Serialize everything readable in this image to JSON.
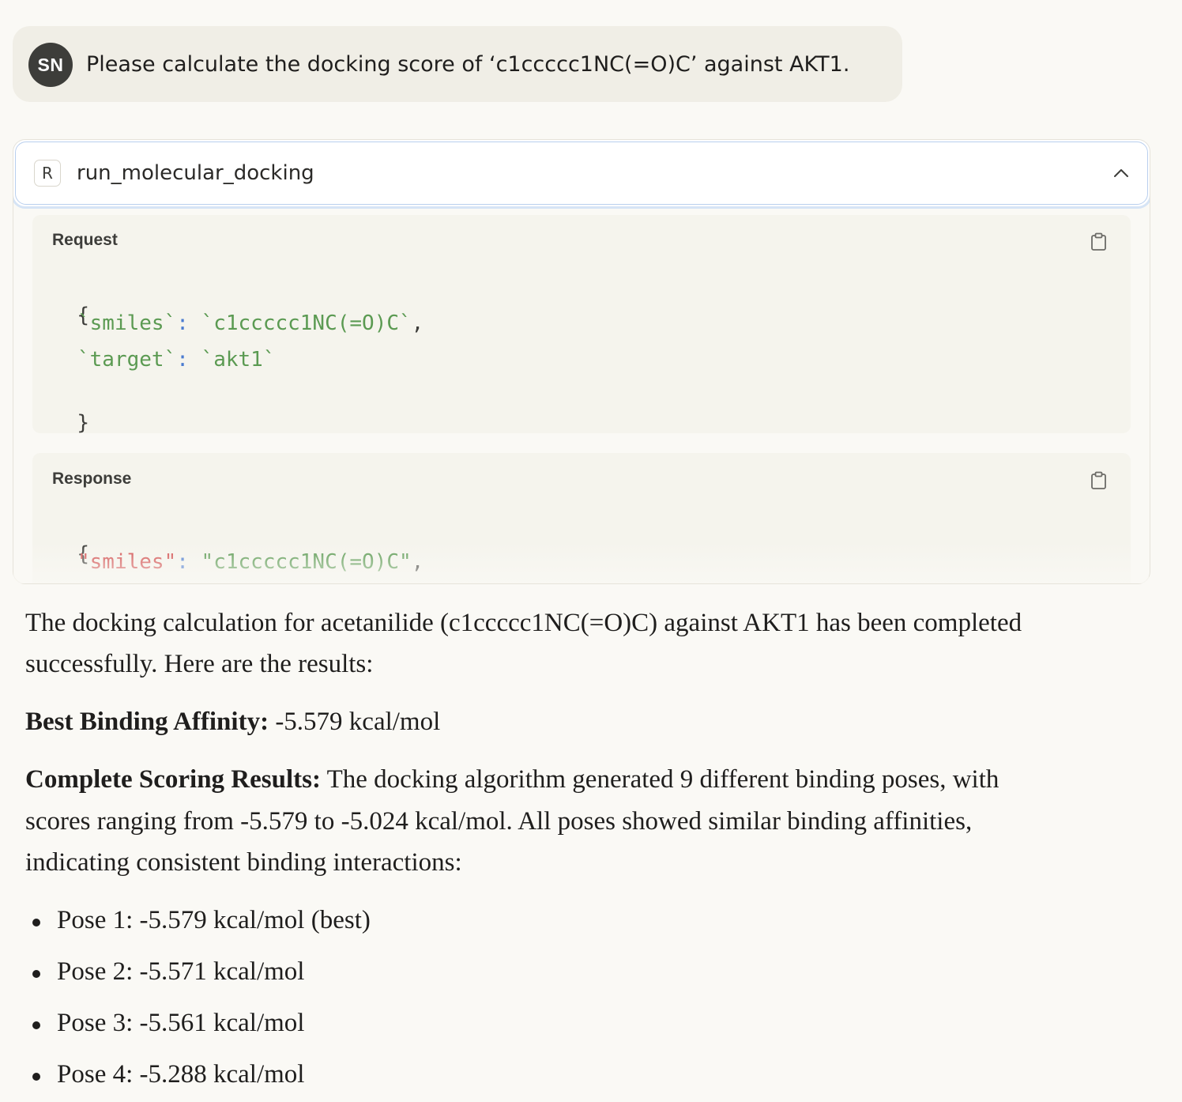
{
  "user_message": {
    "avatar_initials": "SN",
    "text": "Please calculate the docking score of ‘c1ccccc1NC(=O)C’ against AKT1."
  },
  "tool_call": {
    "badge": "R",
    "name": "run_molecular_docking",
    "collapse_icon": "chevron-up-icon",
    "request": {
      "label": "Request",
      "copy_icon": "clipboard-icon",
      "lines": {
        "open": "{",
        "smiles_key": "`smiles`",
        "colon": ":",
        "smiles_value": "`c1ccccc1NC(=O)C`",
        "comma": ",",
        "target_key": "`target`",
        "target_value": "`akt1`",
        "close": "}"
      }
    },
    "response": {
      "label": "Response",
      "copy_icon": "clipboard-icon",
      "lines": {
        "open": "{",
        "smiles_key": "\"smiles\"",
        "colon": ":",
        "smiles_value": "\"c1ccccc1NC(=O)C\"",
        "comma": ","
      }
    }
  },
  "answer": {
    "intro_line1": "The docking calculation for acetanilide (c1ccccc1NC(=O)C) against AKT1 has been completed",
    "intro_line2": "successfully. Here are the results:",
    "best_label": "Best Binding Affinity:",
    "best_value": " -5.579 kcal/mol",
    "complete_label": "Complete Scoring Results:",
    "complete_line1": " The docking algorithm generated 9 different binding poses, with",
    "complete_line2": "scores ranging from -5.579 to -5.024 kcal/mol. All poses showed similar binding affinities,",
    "complete_line3": "indicating consistent binding interactions:",
    "poses": [
      "Pose 1: -5.579 kcal/mol (best)",
      "Pose 2: -5.571 kcal/mol",
      "Pose 3: -5.561 kcal/mol",
      "Pose 4: -5.288 kcal/mol"
    ]
  },
  "colors": {
    "background": "#faf9f5",
    "bubble": "#f0eee6",
    "avatar": "#3d3d3a",
    "code_panel": "#f5f4ed",
    "string_green": "#5b9a52",
    "key_red": "#d25050",
    "punct_blue": "#4a7bd0",
    "focus_ring": "#d6e4f5"
  }
}
